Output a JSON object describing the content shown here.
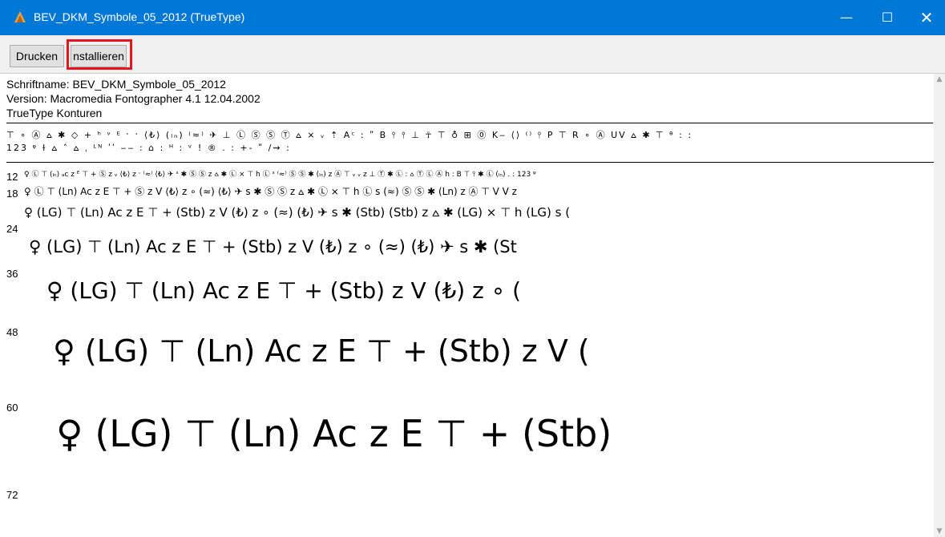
{
  "window": {
    "title": "BEV_DKM_Symbole_05_2012 (TrueType)",
    "minimize_glyph": "—",
    "maximize_glyph": "☐",
    "close_glyph": "✕"
  },
  "toolbar": {
    "print_label": "Drucken",
    "install_label": "nstallieren"
  },
  "info": {
    "font_name": "Schriftname: BEV_DKM_Symbole_05_2012",
    "version": "Version: Macromedia Fontographer 4.1 12.04.2002",
    "outline_type": "TrueType Konturen"
  },
  "preview": {
    "charset_line_1": "⊤ ∘ Ⓐ ⩟ ✱ ◇ + ʰ ᵛ ᴱ ˑ ˑ ⟨₺⟩ (ₗₙ) ⁽≈⁾ ✈ ⊥ Ⓛ Ⓢ Ⓢ Ⓣ ⩟ ⨯ ᵥ ⇡ Aᶜ : ʺ B ⫯ ⫯ ⊥ ☥ ⊤ ♁ ⊞ ⓪ K‒ ⟨⟩ ⁽⁾ ⫯ P ⊤ R ∘ Ⓐ UV ⩟ ✱ ⊤ ᶿ : :",
    "charset_line_2": "123 ᵠ ɫ ⩟ ˄ ⩟ ˌ ᴸᴺ ʹʹ ‒‒ : ⌂ : ᴴ : ᵛ ! ® . : +- ʺ /⇝ :",
    "size_labels": [
      "12",
      "18",
      "24",
      "36",
      "48",
      "60",
      "72"
    ],
    "sample_12": "♀ Ⓛ ⊤ (ₗₙ) ₐc z ᴱ ⊤ + Ⓢ z ᵥ ⟨₺⟩ z ˑ ⁽≈⁾ ⟨₺⟩ ✈ ˢ ✱ Ⓢ Ⓢ z ⩟ ✱ Ⓛ ⨯ ⊤ h Ⓛ ˢ ⁽≈⁾ Ⓢ Ⓢ ✱ (ₗₙ) z Ⓐ ⊤ ᵥ ᵥ z ⊥ Ⓣ ✱ Ⓛ : ⩟ Ⓣ Ⓛ Ⓐ h : B ⊤ ⫯ ✱ Ⓛ (ₗₙ) . : 123 ᵠ",
    "sample_18": "♀ Ⓛ ⊤ (Ln) Ac z E ⊤ + Ⓢ z V ⟨₺⟩ z ∘ (≈) ⟨₺⟩ ✈ s ✱ Ⓢ Ⓢ z ⩟ ✱ Ⓛ ⨯ ⊤ h Ⓛ s (≈) Ⓢ Ⓢ ✱ (Ln) z Ⓐ ⊤ V V z",
    "sample_24": "♀ (LG) ⊤ (Ln) Ac z E ⊤ + (Stb) z V (₺) z ∘ (≈) (₺) ✈ s ✱ (Stb) (Stb) z ⩟ ✱ (LG) ⨯ ⊤ h (LG) s (",
    "sample_36": "♀  (LG)  ⊤  (Ln)  Ac  z  E  ⊤  +  (Stb)  z  V  (₺)  z  ∘  (≈)  (₺)  ✈  s  ✱  (St",
    "sample_48": "♀  (LG)  ⊤  (Ln)  Ac  z  E  ⊤  +  (Stb)  z  V  (₺)  z  ∘  (",
    "sample_60": "♀  (LG)  ⊤  (Ln)  Ac  z  E  ⊤  +  (Stb)  z  V  (",
    "sample_72": "♀   (LG)   ⊤   (Ln)   Ac   z   E   ⊤   +   (Stb)"
  },
  "colors": {
    "titlebar": "#0078d7",
    "highlight_border": "#e8141c"
  }
}
